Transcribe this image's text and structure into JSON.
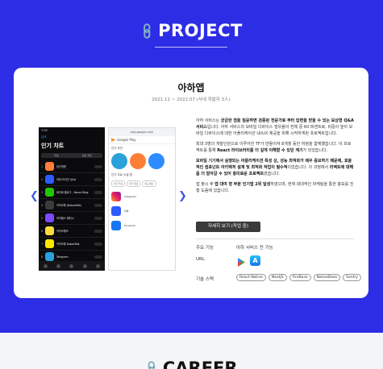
{
  "project": {
    "section_title": "PROJECT",
    "card": {
      "title": "아하앱",
      "period": "2021.11 ~ 2022.07 (사내 개발자 3人)",
      "screens": {
        "ios": {
          "status_time": "7:05",
          "back_label": "검색",
          "title": "인기 차트",
          "segments": [
            "무료",
            "유료 차트"
          ],
          "rows": [
            {
              "rank": "1",
              "name": "당근마켓"
            },
            {
              "rank": "2",
              "name": "아하-지식인 Q&A"
            },
            {
              "rank": "3",
              "name": "네이버 블로그 - Naver Blog"
            },
            {
              "rank": "4",
              "name": "카카오톡 (KakaoTalk)"
            },
            {
              "rank": "5",
              "name": "아이템스 레티시"
            },
            {
              "rank": "6",
              "name": "카카오뱅크"
            },
            {
              "rank": "7",
              "name": "카카오톡 KakaoTalk"
            },
            {
              "rank": "8",
              "name": "Telegram"
            }
          ]
        },
        "android": {
          "url": "play.google.com",
          "store_name": "Google Play",
          "section1": "인기 추천",
          "section2": "인기 무료 소셜 앱",
          "tags": [
            "인기 무료",
            "인기 유료",
            "최고 매출"
          ],
          "apps": [
            "Instagram",
            "아하",
            "Facebook"
          ]
        }
      },
      "description": {
        "p1_prefix": "아하 서비스는 ",
        "p1_bold": "궁금한 점을 질문하면 검증된 전문가로 부터 답변을 받을 수 있는 보상형 Q&A 서비스",
        "p1_suffix": "입니다. 아하 서비스의 모바일 디바이스 점유율이 전체 중 60 퍼센트로, 비중이 높아 모바일 디바이스에 대한 어플리케이션 UI/UX 제공을 위해 시작하게된 프로젝트입니다.",
        "p2_prefix": "최대 3명의 개발인원으로 이루어진 TF가 만들어져 8개월 동안 여정을 함께했습니다. 이 프로젝트를 통해 ",
        "p2_bold": "React 라이브러리를 더 깊게 이해할 수 있던 계기",
        "p2_suffix": "가 되었습니다.",
        "p3_bold": "모바일 기기에서 실행되는 어플리케이션 특성 상, 성능 최적화가 매우 중요하기 때문에, 효율적인 컴포넌트 아키텍처 설계 및 최적화 작업이 필수적",
        "p3_suffix": "이었습니다. 이 과정에서 ",
        "p3_bold2": "리액트에 대해 좀 더 알아갈 수 있어 흥미로운 프로젝트",
        "p3_suffix2": "였습니다.",
        "p4_prefix": "앱 출시 후 ",
        "p4_bold": "앱 대여 형 부분 인기앱 2위 달성",
        "p4_suffix": "하였으며, 현재 대대적인 마케팅을 통한 홍보를 진행 도움에 있습니다."
      },
      "detail_button": "자세히 보기 (작업 중)",
      "meta": {
        "feature_label": "주요 기능",
        "feature_value": "아하 서비스 전 기능",
        "url_label": "URL",
        "stack_label": "기술 스택",
        "stack": [
          "React-Native",
          "NextJS",
          "FireBase",
          "NativeBase",
          "Sentry"
        ]
      }
    },
    "colors": {
      "background": "#2d2de6",
      "arrow": "#3d5bd9"
    }
  },
  "career": {
    "section_title": "CAREER"
  }
}
